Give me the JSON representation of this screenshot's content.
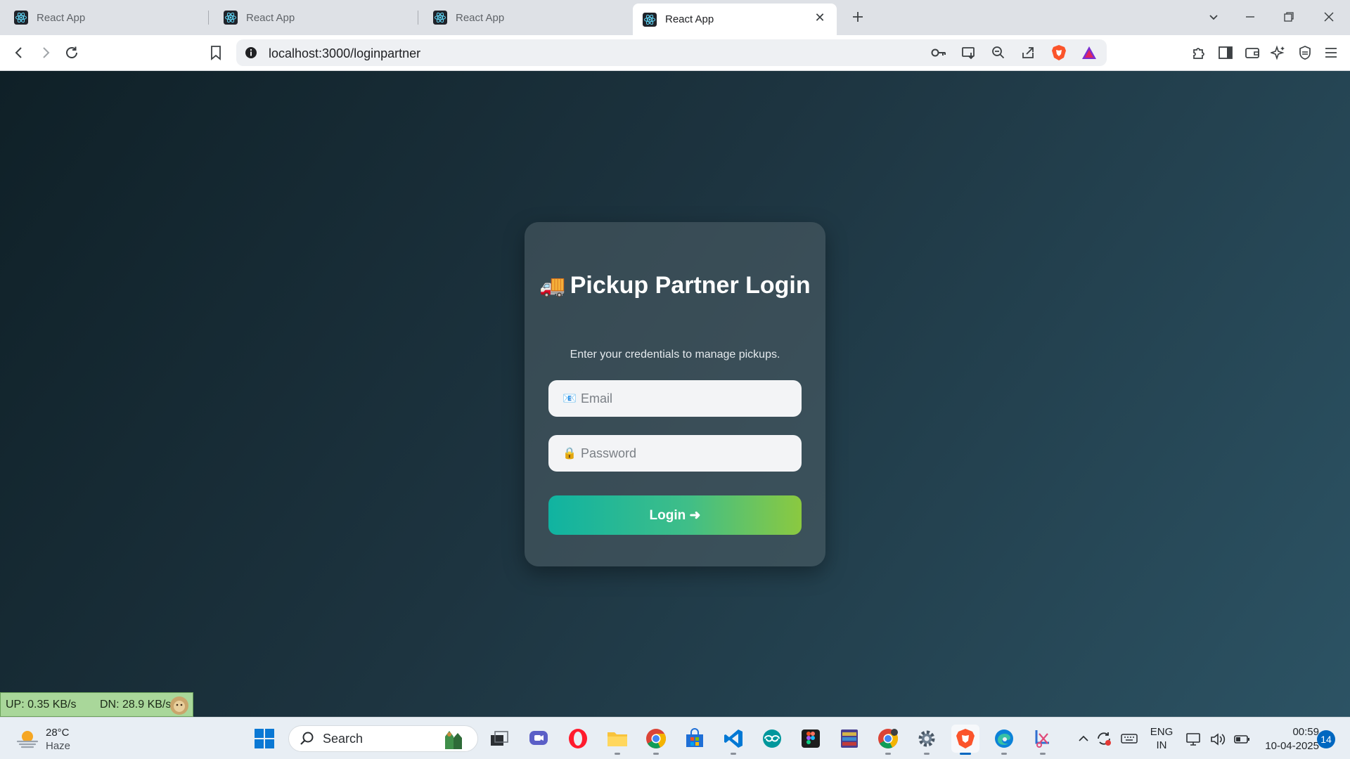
{
  "browser": {
    "tabs": [
      {
        "title": "React App",
        "active": false
      },
      {
        "title": "React App",
        "active": false
      },
      {
        "title": "React App",
        "active": false
      },
      {
        "title": "React App",
        "active": true
      }
    ],
    "new_tab_icon": "plus-icon",
    "url": "localhost:3000/loginpartner"
  },
  "page": {
    "title_emoji": "🚚",
    "title": "Pickup Partner Login",
    "subtitle": "Enter your credentials to manage pickups.",
    "email_icon": "📧",
    "email_placeholder": "Email",
    "email_value": "",
    "password_icon": "🔒",
    "password_placeholder": "Password",
    "password_value": "",
    "login_label": "Login ➜",
    "background_colors": [
      "#0f2027",
      "#2c5364"
    ],
    "button_gradient": [
      "#10b3a1",
      "#8bc940"
    ]
  },
  "netspeed": {
    "up": "UP: 0.35 KB/s",
    "down": "DN: 28.9 KB/s"
  },
  "taskbar": {
    "weather_temp": "28°C",
    "weather_desc": "Haze",
    "search_label": "Search",
    "language": "ENG",
    "region": "IN",
    "time": "00:59",
    "date": "10-04-2025",
    "notification_count": "14"
  }
}
